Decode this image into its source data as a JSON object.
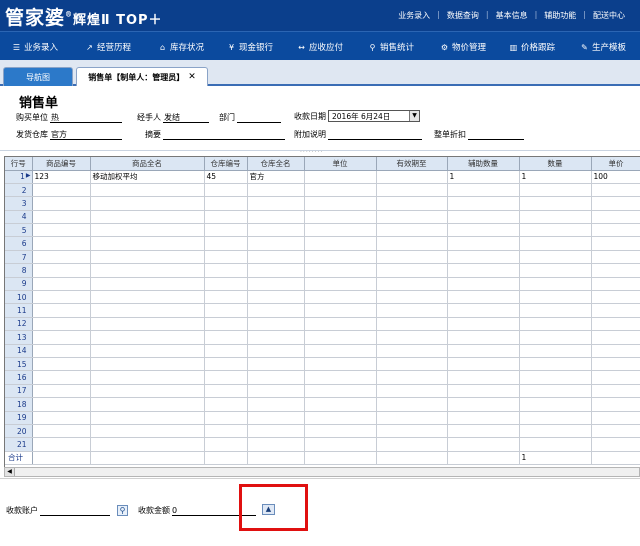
{
  "app": {
    "logo_main": "管家婆",
    "logo_sub": "辉煌Ⅱ TOP＋",
    "logo_reg": "®",
    "top_menu": [
      "业务录入",
      "数据查询",
      "基本信息",
      "辅助功能",
      "配送中心"
    ]
  },
  "nav": {
    "items": [
      {
        "icon": "☰",
        "label": "业务录入"
      },
      {
        "icon": "↗",
        "label": "经营历程"
      },
      {
        "icon": "⌂",
        "label": "库存状况"
      },
      {
        "icon": "¥",
        "label": "现金银行"
      },
      {
        "icon": "↔",
        "label": "应收应付"
      },
      {
        "icon": "⚲",
        "label": "销售统计"
      },
      {
        "icon": "⚙",
        "label": "物价管理"
      },
      {
        "icon": "▥",
        "label": "价格跟踪"
      },
      {
        "icon": "✎",
        "label": "生产模板"
      }
    ]
  },
  "tabs": {
    "nav_tab": "导航图",
    "sales_tab": "销售单【制单人：管理员】",
    "close": "✕"
  },
  "form": {
    "title": "销售单",
    "buyer_label": "购买单位",
    "buyer_value": "热",
    "handler_label": "经手人",
    "handler_value": "发结",
    "dept_label": "部门",
    "dept_value": "",
    "date_label": "收款日期",
    "date_value": "2016年 6月24日",
    "warehouse_label": "发货仓库",
    "warehouse_value": "官方",
    "summary_label": "摘要",
    "summary_value": "",
    "note_label": "附加说明",
    "note_value": "",
    "discount_label": "整单折扣",
    "discount_value": ""
  },
  "grid": {
    "columns": [
      "行号",
      "商品编号",
      "商品全名",
      "仓库编号",
      "仓库全名",
      "单位",
      "有效期至",
      "辅助数量",
      "数量",
      "单价"
    ],
    "rows": [
      [
        "1",
        "123",
        "移动加权平均",
        "45",
        "官方",
        "",
        "",
        "1",
        "1",
        "100"
      ],
      [
        "2",
        "",
        "",
        "",
        "",
        "",
        "",
        "",
        "",
        ""
      ],
      [
        "3",
        "",
        "",
        "",
        "",
        "",
        "",
        "",
        "",
        ""
      ],
      [
        "4",
        "",
        "",
        "",
        "",
        "",
        "",
        "",
        "",
        ""
      ],
      [
        "5",
        "",
        "",
        "",
        "",
        "",
        "",
        "",
        "",
        ""
      ],
      [
        "6",
        "",
        "",
        "",
        "",
        "",
        "",
        "",
        "",
        ""
      ],
      [
        "7",
        "",
        "",
        "",
        "",
        "",
        "",
        "",
        "",
        ""
      ],
      [
        "8",
        "",
        "",
        "",
        "",
        "",
        "",
        "",
        "",
        ""
      ],
      [
        "9",
        "",
        "",
        "",
        "",
        "",
        "",
        "",
        "",
        ""
      ],
      [
        "10",
        "",
        "",
        "",
        "",
        "",
        "",
        "",
        "",
        ""
      ],
      [
        "11",
        "",
        "",
        "",
        "",
        "",
        "",
        "",
        "",
        ""
      ],
      [
        "12",
        "",
        "",
        "",
        "",
        "",
        "",
        "",
        "",
        ""
      ],
      [
        "13",
        "",
        "",
        "",
        "",
        "",
        "",
        "",
        "",
        ""
      ],
      [
        "14",
        "",
        "",
        "",
        "",
        "",
        "",
        "",
        "",
        ""
      ],
      [
        "15",
        "",
        "",
        "",
        "",
        "",
        "",
        "",
        "",
        ""
      ],
      [
        "16",
        "",
        "",
        "",
        "",
        "",
        "",
        "",
        "",
        ""
      ],
      [
        "17",
        "",
        "",
        "",
        "",
        "",
        "",
        "",
        "",
        ""
      ],
      [
        "18",
        "",
        "",
        "",
        "",
        "",
        "",
        "",
        "",
        ""
      ],
      [
        "19",
        "",
        "",
        "",
        "",
        "",
        "",
        "",
        "",
        ""
      ],
      [
        "20",
        "",
        "",
        "",
        "",
        "",
        "",
        "",
        "",
        ""
      ],
      [
        "21",
        "",
        "",
        "",
        "",
        "",
        "",
        "",
        "",
        ""
      ]
    ],
    "total_row": [
      "合计",
      "",
      "",
      "",
      "",
      "",
      "",
      "",
      "1",
      ""
    ]
  },
  "bottom": {
    "account_label": "收款账户",
    "account_value": "",
    "amount_label": "收款金额",
    "amount_value": "0"
  },
  "colors": {
    "header_bg": "#0b3f8c",
    "nav_bg": "#0b4a9e",
    "highlight": "#e01010"
  }
}
